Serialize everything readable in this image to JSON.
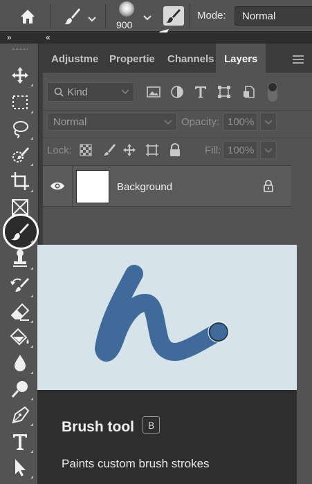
{
  "options_bar": {
    "home_icon": "home-icon",
    "brush_preset_icon": "brush-icon",
    "brush_size": "900",
    "brush_settings_icon": "brush-settings-icon",
    "mode_label": "Mode:",
    "mode_value": "Normal"
  },
  "collapse_strip": {
    "left_glyph": "»",
    "right_glyph": "«"
  },
  "toolbar": {
    "tools": [
      "move-tool",
      "marquee-tool",
      "lasso-tool",
      "quick-selection-tool",
      "crop-tool",
      "frame-tool",
      "brush-tool",
      "clone-stamp-tool",
      "history-brush-tool",
      "eraser-tool",
      "paint-bucket-tool",
      "blur-tool",
      "dodge-tool",
      "pen-tool",
      "type-tool",
      "path-selection-tool"
    ],
    "selected_tool": "brush-tool"
  },
  "panel": {
    "tabs": [
      {
        "label": "Adjustme"
      },
      {
        "label": "Propertie"
      },
      {
        "label": "Channels"
      },
      {
        "label": "Layers"
      }
    ],
    "active_tab": "Layers",
    "filter_kind": "Kind",
    "blend_mode": "Normal",
    "opacity_label": "Opacity:",
    "opacity_value": "100%",
    "lock_label": "Lock:",
    "fill_label": "Fill:",
    "fill_value": "100%",
    "layers": [
      {
        "name": "Background",
        "visible": true,
        "locked": true
      }
    ]
  },
  "tooltip": {
    "title": "Brush tool",
    "shortcut": "B",
    "description": "Paints custom brush strokes",
    "preview_bg": "#d6e3ea",
    "stroke_color": "#3f6a9a"
  }
}
